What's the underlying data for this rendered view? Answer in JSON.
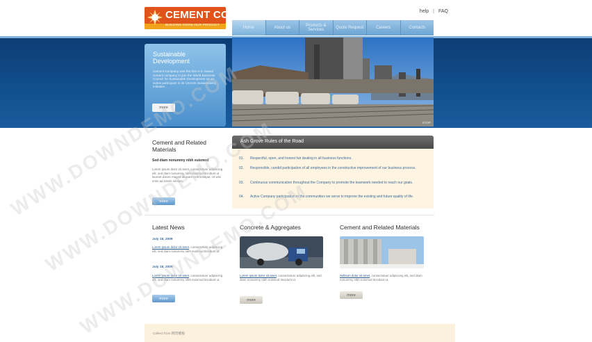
{
  "header": {
    "logo_title": "CEMENT CO.",
    "logo_tagline": "BUILDING KNOW OUR PRODUCT",
    "toplinks": [
      "help",
      "FAQ"
    ]
  },
  "nav": [
    "Home",
    "About us",
    "Products & Services",
    "Quote Request",
    "Careers",
    "Contacts"
  ],
  "promo": {
    "title": "Sustainable Development",
    "text": "Cement Company was the first U.S.-based cement company to join the World Business Council for Sustainable Development as an active participant in its Cement Sustainability Initiative.",
    "button": "more"
  },
  "hero": {
    "stop_label": "STOP"
  },
  "cement_related": {
    "title": "Cement and Related Materials",
    "subtitle": "Sed diam nonummy nibh euismod",
    "text": "Lorem ipsum dolor sit amet, consectetuer adipiscing elit, sed diam nonummy nibh euismod tincidunt ut laoreet dolore magna aliquam erat volutpat. Ut wisi enim ad minim veniam.",
    "button": "more"
  },
  "rules": {
    "title": "Ash Grove Rules of the Road",
    "items": [
      {
        "num": "01.",
        "text": "Respectful, open, and honest fair dealing in all business functions."
      },
      {
        "num": "02.",
        "text": "Responsible, candid participation of all employees in the constructive improvement of our business process."
      },
      {
        "num": "03.",
        "text": "Continuous communication throughout the Company to promote the teamwork needed to reach our goals."
      },
      {
        "num": "04.",
        "text": "Active Company participation in the communities we serve to improve the existing and future quality of life."
      }
    ]
  },
  "news": {
    "title": "Latest News",
    "items": [
      {
        "date": "July 18, 2009",
        "link": "Lorem ipsum dolor sit amet",
        "text": ", consectetuer adipiscing elit, sed diam nonummy nibh euismod tincidunt ut."
      },
      {
        "date": "July 18, 2009",
        "link": "Lorem ipsum dolor sit amet",
        "text": ", consectetuer adipiscing elit, sed diam nonummy nibh euismod tincidunt ut."
      }
    ],
    "button": "more"
  },
  "concrete": {
    "title": "Concrete & Aggregates",
    "link": "Lorem ipsum dolor sit amet",
    "text": ", consectetuer adipiscing elit, sed diam nonummy nibh euismod tincidunt ut.",
    "button": "more"
  },
  "cement2": {
    "title": "Cement and Related Materials",
    "link": "Sellsum dolor sit amet",
    "text": ", consectetuer adipiscing elit, sed diam nonummy nibh euismod tincidunt ut.",
    "button": "more"
  },
  "footer": {
    "text": "Collect from 网页模板"
  },
  "watermark": "WWW.DOWNDEMO.COM",
  "colors": {
    "nav_blue": "#6ba4d2",
    "band_blue": "#11508f",
    "logo_orange": "#e0531a",
    "panel_cream": "#fdf4e2"
  }
}
